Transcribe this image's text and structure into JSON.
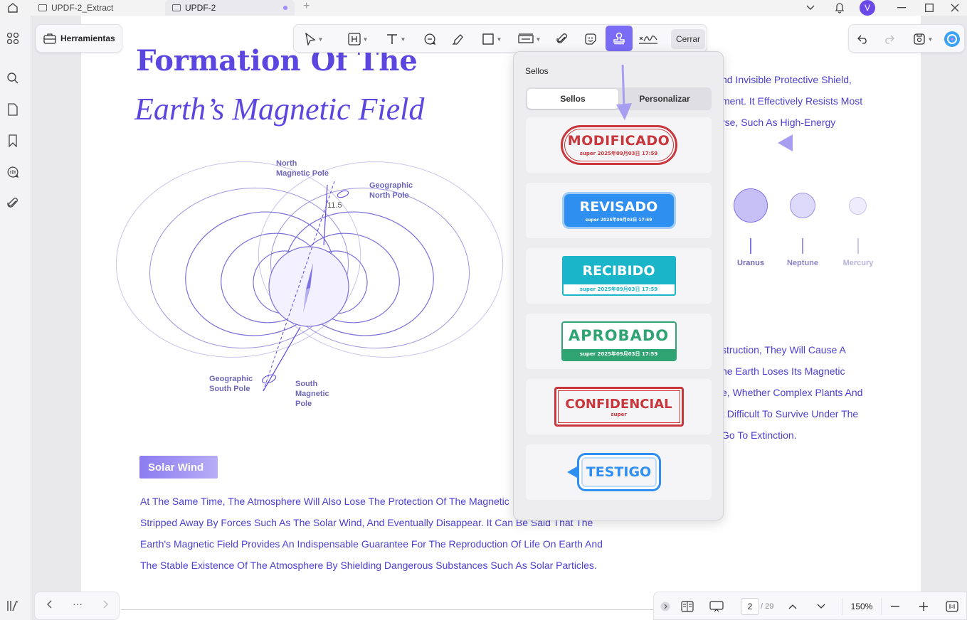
{
  "tabs": [
    {
      "label": "UPDF-2_Extract"
    },
    {
      "label": "UPDF-2"
    }
  ],
  "titlebar": {
    "new_tab": "+",
    "avatar_letter": "V"
  },
  "toolbar": {
    "herramientas_label": "Herramientas",
    "cerrar_label": "Cerrar",
    "tools": [
      "select-tool",
      "text-box-tool",
      "text-tool",
      "comment-tool",
      "highlight-tool",
      "shape-tool",
      "textbox-line-tool",
      "attachment-tool",
      "sticker-tool",
      "stamp-tool",
      "signature-tool"
    ],
    "active_tool": "stamp-tool",
    "accent_color": "#7b6cf6"
  },
  "stamps_panel": {
    "title": "Sellos",
    "tabs": {
      "sellos": "Sellos",
      "personalizar": "Personalizar"
    },
    "selected_tab": "Sellos",
    "stamps": [
      {
        "name": "MODIFICADO",
        "subtitle": "super 2025年09月03日 17:59",
        "color": "#c9363c"
      },
      {
        "name": "REVISADO",
        "subtitle": "super 2025年09月03日 17:59",
        "color": "#2f8ff0"
      },
      {
        "name": "RECIBIDO",
        "subtitle": "super 2025年09月03日 17:59",
        "color": "#1bb5c9"
      },
      {
        "name": "APROBADO",
        "subtitle": "super 2025年09月03日 17:59",
        "color": "#2fa472"
      },
      {
        "name": "CONFIDENCIAL",
        "subtitle": "super",
        "color": "#c9363c"
      },
      {
        "name": "TESTIGO",
        "subtitle": "",
        "color": "#2f8ff0"
      }
    ]
  },
  "document": {
    "title_line1": "Formation Of The",
    "title_line2": "Earth’s Magnetic Field",
    "diagram_labels": {
      "north_magnetic": "North\nMagnetic Pole",
      "geo_north": "Geographic\nNorth Pole",
      "angle": "11.5",
      "geo_south": "Geographic\nSouth Pole",
      "south_magnetic": "South\nMagnetic\nPole"
    },
    "solar_wind_badge": "Solar Wind",
    "paragraph": [
      "At The Same Time, The Atmosphere Will Also Lose The Protection Of The Magnetic",
      "Stripped Away By Forces Such As The Solar Wind, And Eventually Disappear. It Can Be Said That The",
      "Earth's Magnetic Field Provides An Indispensable Guarantee For The Reproduction Of Life On Earth And",
      "The Stable Existence Of The Atmosphere By Shielding Dangerous Substances Such As Solar Particles."
    ],
    "right_top_lines": [
      "nd Invisible Protective Shield,",
      "ment. It Effectively Resists Most",
      "rse, Such As High-Energy"
    ],
    "planets": [
      "Uranus",
      "Neptune",
      "Mercury"
    ],
    "right_bottom_lines": [
      "struction, They Will Cause A",
      "he Earth Loses Its Magnetic",
      "e, Whether Complex Plants And",
      "t Difficult To Survive Under The",
      "Go To Extinction."
    ],
    "text_color": "#4a3fd0"
  },
  "navigation": {
    "more": "···"
  },
  "status": {
    "current_page": "2",
    "total_pages": "/ 29",
    "zoom": "150%"
  }
}
